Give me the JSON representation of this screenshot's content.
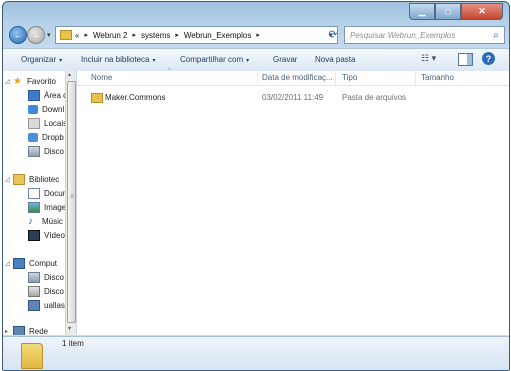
{
  "window": {
    "caption_buttons": {
      "minimize": "▁",
      "maximize": "□",
      "close": "✕"
    }
  },
  "navbar": {
    "back_icon": "←",
    "forward_icon": "→",
    "history_icon": "▾",
    "overflow": "«",
    "separator": "▸",
    "breadcrumbs": [
      "Webrun 2",
      "systems",
      "Webrun_Exemplos"
    ],
    "dropdown_icon": "▾",
    "refresh_icon": "⟳",
    "search_placeholder": "Pesquisar Webrun_Exemplos",
    "search_icon": "⌕"
  },
  "toolbar": {
    "organize": "Organizar",
    "include": "Incluir na biblioteca",
    "share": "Compartilhar com",
    "burn": "Gravar",
    "new_folder": "Nova pasta",
    "caret": "▾",
    "views_icon": "☷ ▾",
    "help_icon": "?"
  },
  "nav_pane": {
    "expand_icon": "▸",
    "collapse_icon": "◿",
    "star_icon": "★",
    "music_icon": "♪",
    "favorites": "Favorito",
    "favorite_items": [
      "Área d",
      "Downl",
      "Locais",
      "Dropb",
      "Disco l"
    ],
    "libraries": "Bibliotec",
    "library_items": [
      "Docun",
      "Image",
      "Músic",
      "Vídeos"
    ],
    "computer": "Comput",
    "computer_items": [
      "Disco l",
      "Disco l",
      "uallasf"
    ],
    "network": "Rede",
    "scroll_up": "▴",
    "scroll_down": "▾",
    "scroll_grip": "≡"
  },
  "columns": {
    "name": "Nome",
    "date": "Data de modificaç...",
    "type": "Tipo",
    "size": "Tamanho",
    "sort_indicator": "^"
  },
  "files": [
    {
      "name": "Maker.Commons",
      "date": "03/02/2011 11:49",
      "type": "Pasta de arquivos",
      "size": ""
    }
  ],
  "status": {
    "count": "1 item"
  },
  "colors": {
    "accent": "#2f6bb4",
    "chrome": "#c5dbee",
    "folder": "#e8c34a"
  }
}
